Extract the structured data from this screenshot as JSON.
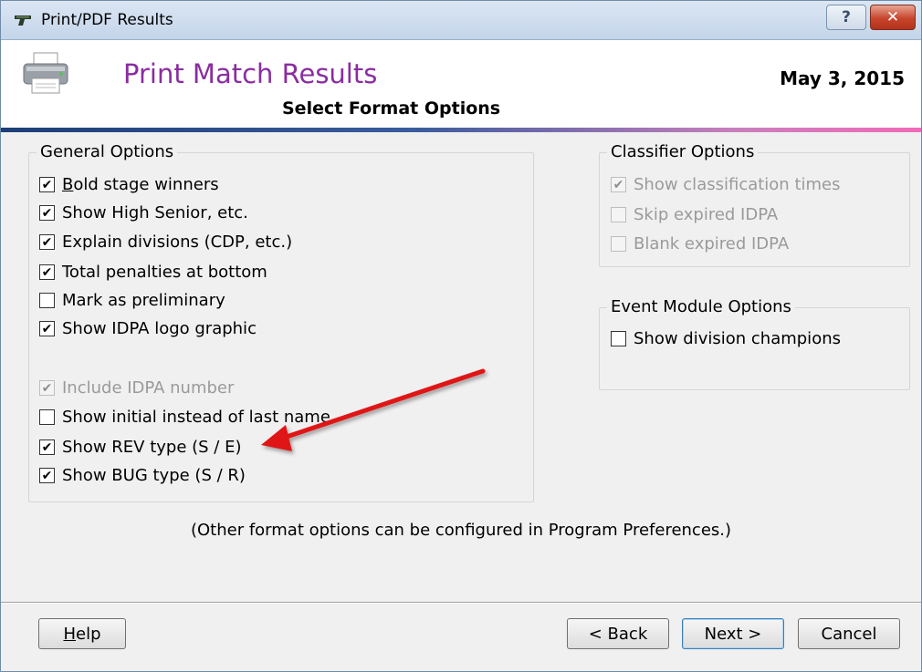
{
  "window": {
    "title": "Print/PDF Results",
    "help_glyph": "?",
    "close_glyph": "✕"
  },
  "header": {
    "title": "Print Match Results",
    "subtitle": "Select Format Options",
    "date": "May  3, 2015"
  },
  "general": {
    "legend": "General Options",
    "bold_prefix": "B",
    "bold_rest": "old stage winners",
    "items": [
      {
        "label": "Show High Senior, etc.",
        "checked": true,
        "disabled": false
      },
      {
        "label": "Explain divisions (CDP, etc.)",
        "checked": true,
        "disabled": false
      },
      {
        "label": "Total penalties at bottom",
        "checked": true,
        "disabled": false
      },
      {
        "label": "Mark as preliminary",
        "checked": false,
        "disabled": false
      },
      {
        "label": " Show IDPA logo graphic",
        "checked": true,
        "disabled": false
      },
      {
        "label": "Include IDPA number",
        "checked": true,
        "disabled": true
      },
      {
        "label": "Show initial instead of last name",
        "checked": false,
        "disabled": false
      },
      {
        "label": "Show REV type (S / E)",
        "checked": true,
        "disabled": false
      },
      {
        "label": "Show BUG type (S / R)",
        "checked": true,
        "disabled": false
      }
    ]
  },
  "classifier": {
    "legend": "Classifier Options",
    "items": [
      {
        "label": "Show classification  times",
        "checked": true,
        "disabled": true
      },
      {
        "label": "Skip expired IDPA",
        "checked": false,
        "disabled": true
      },
      {
        "label": "Blank expired IDPA",
        "checked": false,
        "disabled": true
      }
    ]
  },
  "event": {
    "legend": "Event Module Options",
    "items": [
      {
        "label": "Show division champions",
        "checked": false,
        "disabled": false
      }
    ]
  },
  "note": "(Other format options can be configured in Program Preferences.)",
  "buttons": {
    "help_underline": "H",
    "help_rest": "elp",
    "back": "< Back",
    "next": "Next >",
    "cancel": "Cancel"
  },
  "check_glyph": "✔",
  "colors": {
    "title": "#8a2da0",
    "arrow": "#e01818",
    "accent_start": "#1d3e78",
    "accent_end": "#f06bb7"
  },
  "icons": {
    "app": "pistol-icon",
    "header": "printer-icon"
  }
}
